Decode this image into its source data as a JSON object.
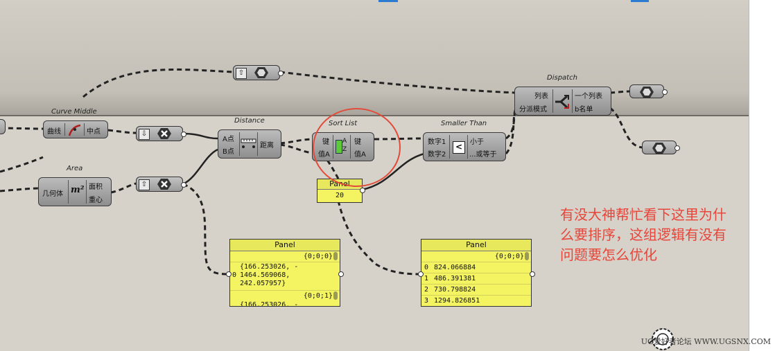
{
  "components": {
    "curve_middle": {
      "title": "Curve Middle",
      "in": "曲线",
      "out": "中点"
    },
    "distance": {
      "title": "Distance",
      "in1": "A点",
      "in2": "B点",
      "out": "距离"
    },
    "sort_list": {
      "title": "Sort List",
      "in1": "键",
      "in2": "值A",
      "out1": "键",
      "out2": "值A",
      "icon_top": "A",
      "icon_bottom": "Z"
    },
    "smaller_than": {
      "title": "Smaller Than",
      "in1": "数字1",
      "in2": "数字2",
      "out1": "小于",
      "out2": "...或等于",
      "icon": "<"
    },
    "dispatch": {
      "title": "Dispatch",
      "in1": "列表",
      "in2": "分派模式",
      "out1": "一个列表",
      "out2": "b名单"
    },
    "area": {
      "title": "Area",
      "in": "几何体",
      "out1": "面积",
      "out2": "重心",
      "icon": "m²"
    }
  },
  "panels": {
    "small": {
      "title": "Panel",
      "value": "20"
    },
    "left": {
      "title": "Panel",
      "path1": "{0;0;0}",
      "index": "0",
      "line1": "{166.253026, -",
      "line2": "1464.569068,",
      "line3": "242.057957}",
      "path2": "{0;0;1}",
      "line4": "{166.253026, -"
    },
    "right": {
      "title": "Panel",
      "path": "{0;0;0}",
      "rows": [
        {
          "index": "0",
          "value": "824.066884"
        },
        {
          "index": "1",
          "value": "486.391381"
        },
        {
          "index": "2",
          "value": "730.798824"
        },
        {
          "index": "3",
          "value": "1294.826851"
        }
      ]
    }
  },
  "annotation": {
    "line1": "有没大神帮忙看下这里为什",
    "line2": "么要排序，这组逻辑有没有",
    "line3": "问题要怎么优化"
  },
  "watermark": "UG爱好者论坛 WWW.UGSNX.COM",
  "icons": {
    "hex": "hexagon-param-icon",
    "x": "x-cross-icon",
    "up": "flatten-arrow-icon",
    "down": "graft-arrow-icon"
  },
  "colors": {
    "canvas": "#d6d2c9",
    "panel": "#f4f463",
    "annotation": "#e8453a",
    "highlight": "#e24b3a"
  }
}
